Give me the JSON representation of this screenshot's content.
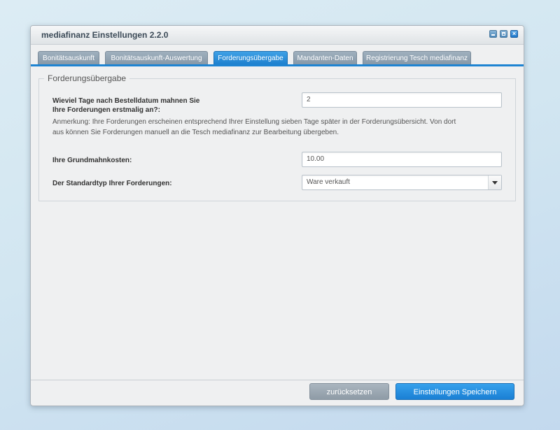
{
  "window": {
    "title": "mediafinanz Einstellungen 2.2.0",
    "controls": {
      "minimize": "minimize-icon",
      "maximize": "maximize-icon",
      "close": "×"
    }
  },
  "tabs": [
    {
      "label": "Bonitätsauskunft",
      "active": false
    },
    {
      "label": "Bonitätsauskunft-Auswertung",
      "active": false
    },
    {
      "label": "Forderungsübergabe",
      "active": true
    },
    {
      "label": "Mandanten-Daten",
      "active": false
    },
    {
      "label": "Registrierung Tesch mediafinanz",
      "active": false
    }
  ],
  "section": {
    "legend": "Forderungsübergabe",
    "days_label_line1": "Wieviel Tage nach Bestelldatum mahnen Sie",
    "days_label_line2": "Ihre Forderungen erstmalig an?:",
    "days_value": "2",
    "note_line1": "Anmerkung: Ihre Forderungen erscheinen entsprechend Ihrer Einstellung sieben Tage später in der Forderungsübersicht. Von dort",
    "note_line2": "aus können Sie Forderungen manuell an die Tesch mediafinanz zur Bearbeitung übergeben.",
    "cost_label": "Ihre Grundmahnkosten:",
    "cost_value": "10.00",
    "type_label": "Der Standardtyp Ihrer Forderungen:",
    "type_value": "Ware verkauft"
  },
  "footer": {
    "reset_label": "zurücksetzen",
    "save_label": "Einstellungen Speichern"
  },
  "colors": {
    "accent": "#1e84d2",
    "tab_inactive": "#8f9fae",
    "button_disabled": "#9aa6b1"
  }
}
